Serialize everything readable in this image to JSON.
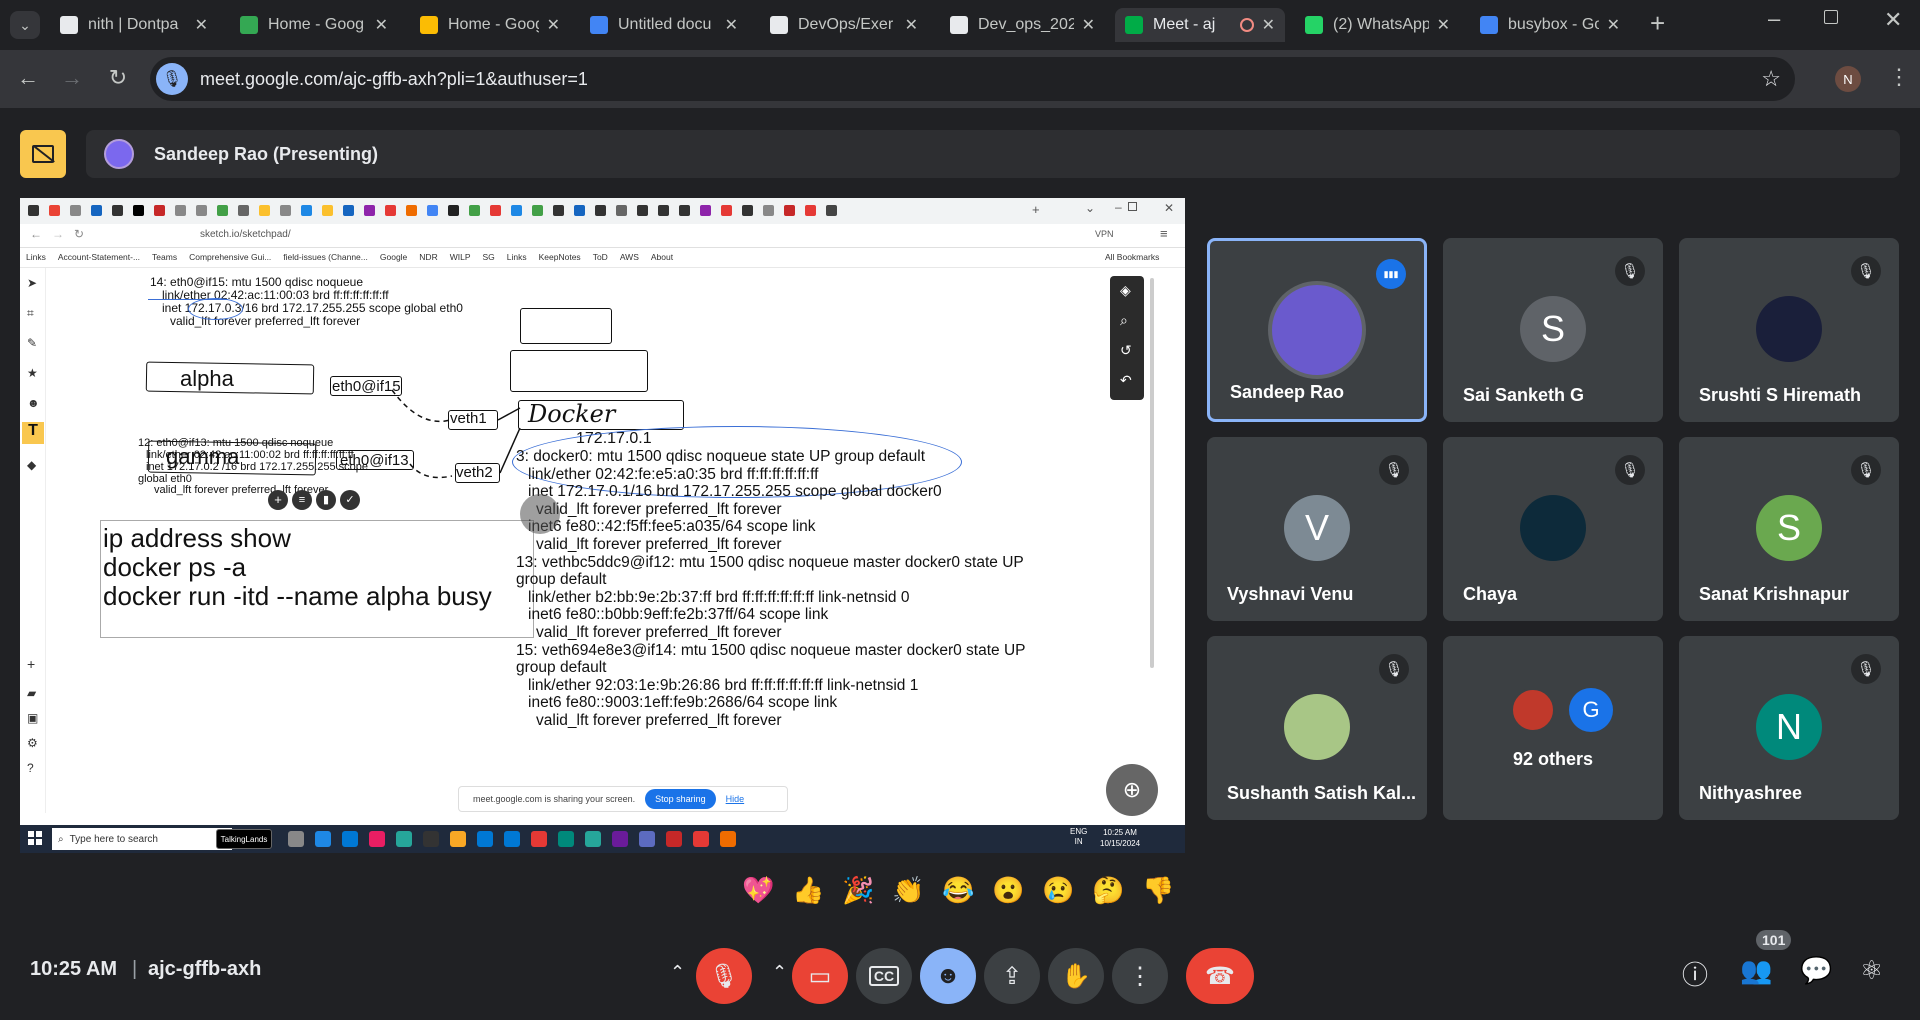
{
  "browser": {
    "tabs": [
      {
        "title": "nith | Dontpa",
        "icon": "notepad-icon",
        "color": "#e8eaed"
      },
      {
        "title": "Home - Goog",
        "icon": "drive-icon",
        "color": "#34a853"
      },
      {
        "title": "Home - Goog",
        "icon": "drive-icon",
        "color": "#fbbc04"
      },
      {
        "title": "Untitled docu",
        "icon": "docs-icon",
        "color": "#4285f4"
      },
      {
        "title": "DevOps/Exer",
        "icon": "github-icon",
        "color": "#e8eaed"
      },
      {
        "title": "Dev_ops_202",
        "icon": "slides-icon",
        "color": "#e8eaed"
      },
      {
        "title": "Meet - aj",
        "icon": "meet-icon",
        "color": "#00ac47",
        "active": true
      },
      {
        "title": "(2) WhatsApp",
        "icon": "whatsapp-icon",
        "color": "#25d366"
      },
      {
        "title": "busybox - Go",
        "icon": "google-icon",
        "color": "#4285f4"
      }
    ],
    "url": "meet.google.com/ajc-gffb-axh?pli=1&authuser=1",
    "profile_initial": "N"
  },
  "meet": {
    "presenter": "Sandeep Rao (Presenting)",
    "time": "10:25 AM",
    "separator": "|",
    "meeting_code": "ajc-gffb-axh",
    "participants_count": "101",
    "participants": [
      {
        "name": "Sandeep Rao",
        "initial": "",
        "color": "#6a5acd",
        "speaking": true
      },
      {
        "name": "Sai Sanketh G",
        "initial": "S",
        "color": "#5f6368"
      },
      {
        "name": "Srushti S Hiremath",
        "initial": "",
        "color": "#1a1f3a"
      },
      {
        "name": "Vyshnavi Venu",
        "initial": "V",
        "color": "#7d8a94"
      },
      {
        "name": "Chaya",
        "initial": "",
        "color": "#0d2a3a"
      },
      {
        "name": "Sanat Krishnapur",
        "initial": "S",
        "color": "#6aa84f"
      },
      {
        "name": "Sushanth Satish Kal...",
        "initial": "",
        "color": "#a8c686"
      },
      {
        "name": "92 others",
        "initial": "G",
        "color": "#1a73e8"
      },
      {
        "name": "Nithyashree",
        "initial": "N",
        "color": "#00897b"
      }
    ],
    "reactions": [
      "💖",
      "👍",
      "🎉",
      "👏",
      "😂",
      "😮",
      "😢",
      "🤔",
      "👎"
    ]
  },
  "shared_screen": {
    "url": "sketch.io/sketchpad/",
    "bookmarks": [
      "Links",
      "Account-Statement-...",
      "Teams",
      "Comprehensive Gui...",
      "field-issues (Channe...",
      "Google",
      "NDR",
      "WILP",
      "SG",
      "Links",
      "KeepNotes",
      "ToD",
      "AWS",
      "About"
    ],
    "all_bookmarks": "All Bookmarks",
    "vpn": "VPN",
    "terminal_top": [
      "14: eth0@if15:  mtu 1500 qdisc noqueue",
      "link/ether 02:42:ac:11:00:03 brd ff:ff:ff:ff:ff:ff",
      "inet 172.17.0.3/16 brd 172.17.255.255 scope global eth0",
      "valid_lft forever preferred_lft forever"
    ],
    "terminal_mid": [
      "12: eth0@if13:  mtu 1500 qdisc noqueue",
      "link/ether 02:42:ac:11:00:02 brd ff:ff:ff:ff:ff:ff",
      "inet  172.17.0.2 /16 brd 172.17.255.255 scope",
      "global eth0",
      "valid_lft forever preferred_lft forever"
    ],
    "terminal_right": [
      "3: docker0:  mtu 1500 qdisc noqueue state UP group default",
      "link/ether 02:42:fe:e5:a0:35 brd ff:ff:ff:ff:ff:ff",
      "inet 172.17.0.1/16 brd 172.17.255.255 scope global docker0",
      "valid_lft forever preferred_lft forever",
      "inet6 fe80::42:f5ff:fee5:a035/64 scope link",
      "valid_lft forever preferred_lft forever",
      "13: vethbc5ddc9@if12:  mtu 1500 qdisc noqueue master docker0 state UP",
      "group default",
      "link/ether b2:bb:9e:2b:37:ff brd ff:ff:ff:ff:ff:ff link-netnsid 0",
      "inet6 fe80::b0bb:9eff:fe2b:37ff/64 scope link",
      "valid_lft forever preferred_lft forever",
      "15: veth694e8e3@if14:  mtu 1500 qdisc noqueue master docker0 state UP",
      "group default",
      "link/ether 92:03:1e:9b:26:86 brd ff:ff:ff:ff:ff:ff link-netnsid 1",
      "inet6 fe80::9003:1eff:fe9b:2686/64 scope link",
      "valid_lft forever preferred_lft forever"
    ],
    "labels": {
      "alpha": "alpha",
      "gamma": "gamma",
      "eth15": "eth0@if15",
      "eth13": "eth0@if13",
      "veth1": "veth1",
      "veth2": "veth2",
      "docker": "Docker",
      "ip": "172.17.0.1"
    },
    "commands": [
      "ip address show",
      "docker ps -a",
      "docker run -itd --name alpha busy"
    ],
    "sharing_text": "meet.google.com is sharing your screen.",
    "stop_sharing": "Stop sharing",
    "hide": "Hide",
    "taskbar_search": "Type here to search",
    "talking_lands": "TalkingLands",
    "lang": "ENG",
    "region": "IN",
    "clock_time": "10:25 AM",
    "clock_date": "10/15/2024"
  }
}
